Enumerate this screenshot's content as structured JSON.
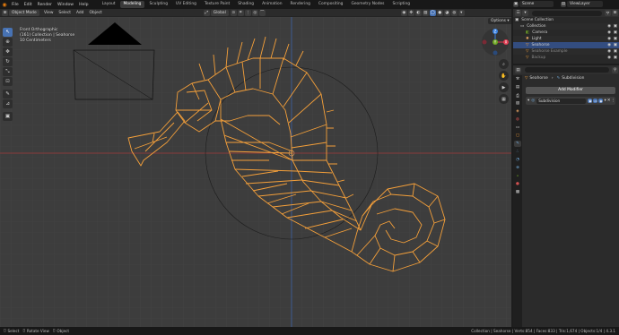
{
  "topbar": {
    "menus": [
      "File",
      "Edit",
      "Render",
      "Window",
      "Help"
    ],
    "workspaces": [
      "Layout",
      "Modeling",
      "Sculpting",
      "UV Editing",
      "Texture Paint",
      "Shading",
      "Animation",
      "Rendering",
      "Compositing",
      "Geometry Nodes",
      "Scripting"
    ],
    "active_workspace": "Modeling",
    "scene_label": "Scene",
    "view_layer_label": "ViewLayer"
  },
  "viewport_header": {
    "mode": "Object Mode",
    "menus": [
      "View",
      "Select",
      "Add",
      "Object"
    ],
    "transform_orientation": "Global",
    "options_label": "Options"
  },
  "viewport_overlay": {
    "view_name": "Front Orthographic",
    "collection_info": "(161) Collection | Seahorse",
    "scale_info": "10 Centimeters"
  },
  "gizmo": {
    "axis_z": "Z",
    "axis_y": "Y",
    "axis_x": "X",
    "x_color": "#e0394f",
    "y_color": "#6ea623",
    "z_color": "#3b82e0"
  },
  "outliner": {
    "rows": [
      {
        "label": "Scene Collection",
        "icon": "scene-collection-icon"
      },
      {
        "label": "Collection",
        "icon": "collection-icon"
      },
      {
        "label": "Camera",
        "icon": "camera-icon"
      },
      {
        "label": "Light",
        "icon": "light-icon"
      },
      {
        "label": "Seahorse",
        "icon": "mesh-icon"
      },
      {
        "label": "Seahorse Example",
        "icon": "mesh-icon"
      },
      {
        "label": "Backup",
        "icon": "mesh-icon"
      }
    ]
  },
  "properties": {
    "breadcrumb_object": "Seahorse",
    "breadcrumb_modifier": "Subdivision",
    "add_modifier_label": "Add Modifier",
    "modifier_name": "Subdivision"
  },
  "statusbar": {
    "left": [
      {
        "label": "Select",
        "icon": "mouse-left-icon"
      },
      {
        "label": "Rotate View",
        "icon": "mouse-middle-icon"
      },
      {
        "label": "Object",
        "icon": "mouse-right-icon"
      }
    ],
    "right": "Collection | Seahorse | Verts:854 | Faces:833 | Tris:1,674 | Objects:1/4 | 4.3.1"
  },
  "colors": {
    "accent": "#4772b3",
    "selection_orange": "#f5a03a",
    "viewport_bg": "#3d3d3d"
  }
}
